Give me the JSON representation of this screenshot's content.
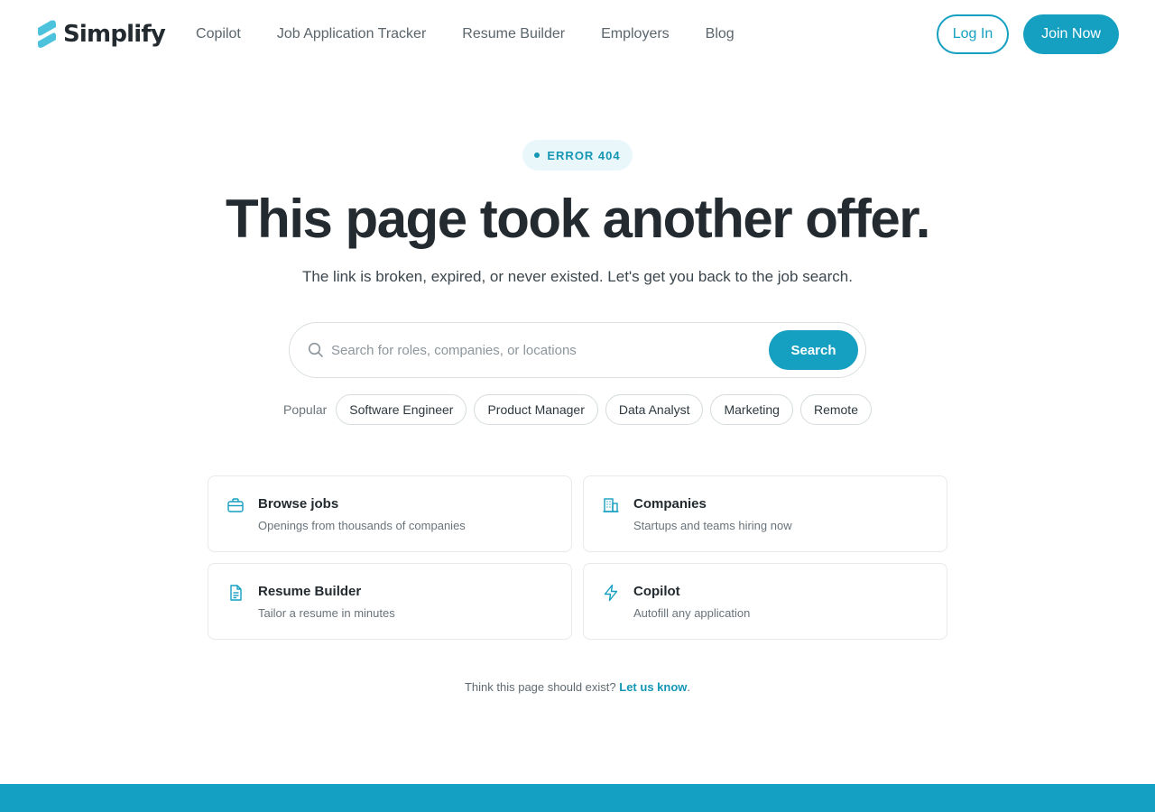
{
  "brand": {
    "name": "Simplify",
    "accent": "#159fc0",
    "logo_color": "#4cc2dd"
  },
  "nav": [
    {
      "label": "Copilot"
    },
    {
      "label": "Job Application Tracker"
    },
    {
      "label": "Resume Builder"
    },
    {
      "label": "Employers"
    },
    {
      "label": "Blog"
    }
  ],
  "header": {
    "login_label": "Log In",
    "join_label": "Join Now"
  },
  "hero": {
    "badge": "ERROR 404",
    "title": "This page took another offer.",
    "subtitle": "The link is broken, expired, or never existed. Let's get you back to the job search."
  },
  "search": {
    "placeholder": "Search for roles, companies, or locations",
    "value": "",
    "button_label": "Search",
    "icon": "search-icon"
  },
  "popular": {
    "label": "Popular",
    "chips": [
      "Software Engineer",
      "Product Manager",
      "Data Analyst",
      "Marketing",
      "Remote"
    ]
  },
  "cards": [
    {
      "title": "Browse jobs",
      "desc": "Openings from thousands of companies",
      "icon": "briefcase-icon"
    },
    {
      "title": "Companies",
      "desc": "Startups and teams hiring now",
      "icon": "building-icon"
    },
    {
      "title": "Resume Builder",
      "desc": "Tailor a resume in minutes",
      "icon": "document-icon"
    },
    {
      "title": "Copilot",
      "desc": "Autofill any application",
      "icon": "lightning-icon"
    }
  ],
  "feedback": {
    "text": "Think this page should exist?",
    "link_label": "Let us know",
    "suffix": "."
  }
}
